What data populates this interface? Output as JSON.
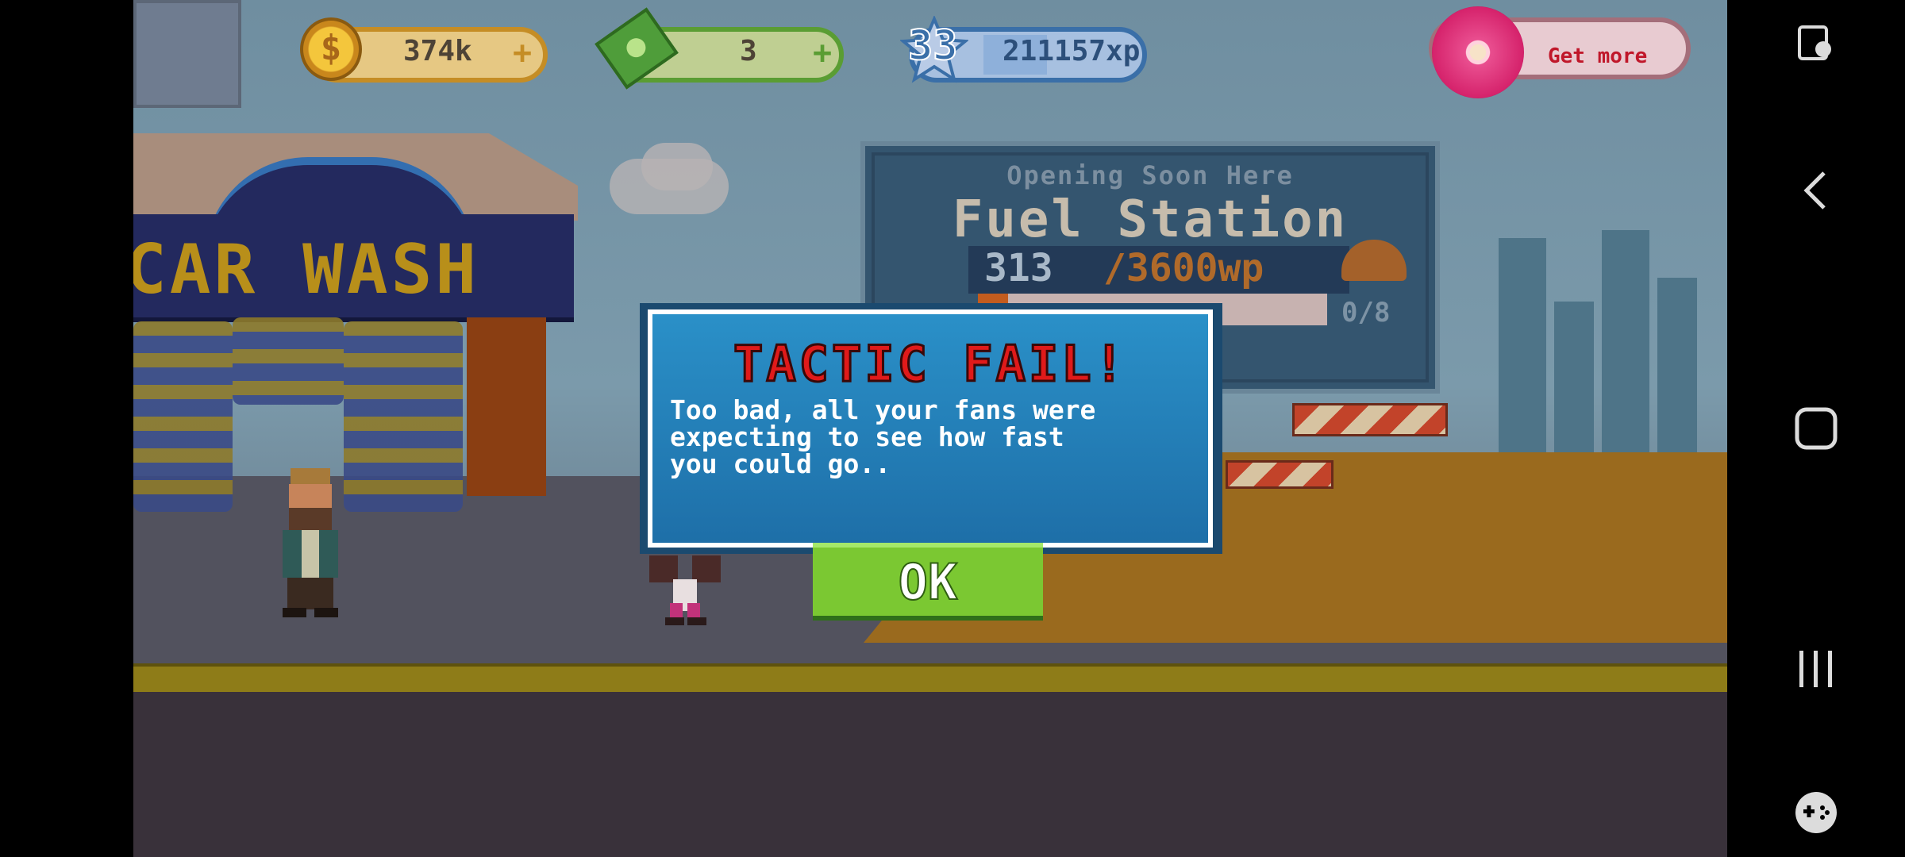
{
  "hud": {
    "coins": "374k",
    "cash": "3",
    "level": "33",
    "xp": "211157xp",
    "get_more": "Get more",
    "plus_symbol": "+",
    "coin_symbol": "$"
  },
  "scene": {
    "carwash_sign": "CAR WASH"
  },
  "fuel_station": {
    "subtitle": "Opening Soon Here",
    "title": "Fuel Station",
    "progress_current": "313",
    "progress_target": "/3600wp",
    "progress_fraction": 0.087,
    "slots": "0/8"
  },
  "dialog": {
    "title": "TACTIC FAIL!",
    "message": "Too bad, all your fans were\nexpecting to see how fast\nyou could go..",
    "ok_label": "OK"
  },
  "colors": {
    "dialog_bg": "#2a90c8",
    "title_red": "#e01a1a",
    "ok_green": "#7bc832"
  },
  "nav": {
    "icons": [
      "accessibility-icon",
      "back-icon",
      "home-icon",
      "recents-icon",
      "game-controller-icon"
    ]
  }
}
